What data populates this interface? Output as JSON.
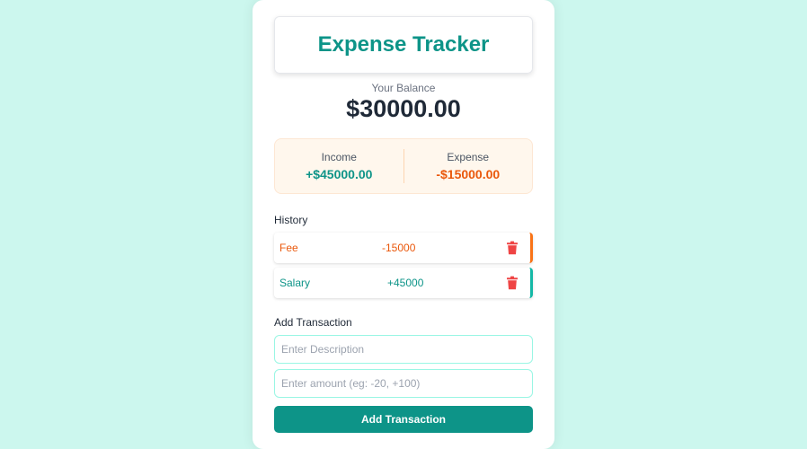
{
  "app": {
    "title": "Expense Tracker"
  },
  "balance": {
    "label": "Your Balance",
    "value": "$30000.00"
  },
  "summary": {
    "income_label": "Income",
    "income_value": "+$45000.00",
    "expense_label": "Expense",
    "expense_value": "-$15000.00"
  },
  "history": {
    "label": "History",
    "items": [
      {
        "description": "Fee",
        "amount": "-15000",
        "type": "expense",
        "icon": "trash-icon"
      },
      {
        "description": "Salary",
        "amount": "+45000",
        "type": "income",
        "icon": "trash-icon"
      }
    ]
  },
  "form": {
    "label": "Add Transaction",
    "description_placeholder": "Enter Description",
    "amount_placeholder": "Enter amount (eg: -20, +100)",
    "submit_label": "Add Transaction"
  },
  "colors": {
    "background": "#ccf7ee",
    "accent": "#0d9488",
    "expense": "#ea580c",
    "delete": "#ef4444"
  }
}
